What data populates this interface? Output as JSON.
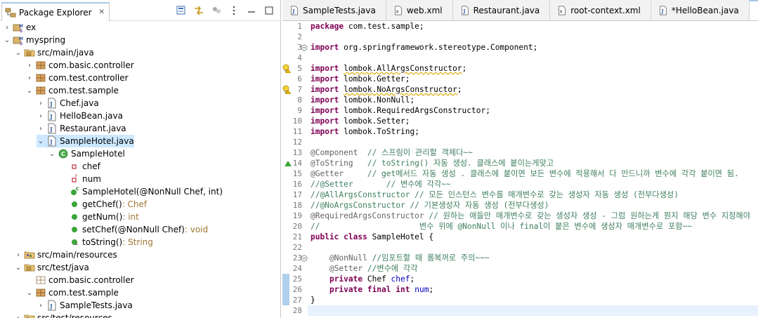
{
  "explorer": {
    "title": "Package Explorer",
    "tree": [
      {
        "label": "ex",
        "twisty": "›",
        "icon": "project",
        "indent": 0
      },
      {
        "label": "myspring",
        "twisty": "⌄",
        "icon": "project",
        "indent": 0
      },
      {
        "label": "src/main/java",
        "twisty": "⌄",
        "icon": "srcfolder",
        "indent": 1
      },
      {
        "label": "com.basic.controller",
        "twisty": "›",
        "icon": "package",
        "indent": 2
      },
      {
        "label": "com.test.controller",
        "twisty": "›",
        "icon": "package",
        "indent": 2
      },
      {
        "label": "com.test.sample",
        "twisty": "⌄",
        "icon": "package",
        "indent": 2
      },
      {
        "label": "Chef.java",
        "twisty": "›",
        "icon": "javafile",
        "indent": 3
      },
      {
        "label": "HelloBean.java",
        "twisty": "›",
        "icon": "javafile",
        "indent": 3
      },
      {
        "label": "Restaurant.java",
        "twisty": "›",
        "icon": "javafile",
        "indent": 3
      },
      {
        "label": "SampleHotel.java",
        "twisty": "⌄",
        "icon": "javafile",
        "indent": 3,
        "selected": true
      },
      {
        "label": "SampleHotel",
        "twisty": "⌄",
        "icon": "class",
        "indent": 4
      },
      {
        "label": "chef",
        "twisty": "",
        "icon": "field-private",
        "indent": 5
      },
      {
        "label": "num",
        "twisty": "",
        "icon": "field-final",
        "indent": 5
      },
      {
        "label": "SampleHotel(@NonNull Chef, int)",
        "twisty": "",
        "icon": "constructor",
        "indent": 5
      },
      {
        "label": "getChef()",
        "suffix": " : Chef",
        "twisty": "",
        "icon": "method",
        "indent": 5
      },
      {
        "label": "getNum()",
        "suffix": " : int",
        "twisty": "",
        "icon": "method",
        "indent": 5
      },
      {
        "label": "setChef(@NonNull Chef)",
        "suffix": " : void",
        "twisty": "",
        "icon": "method",
        "indent": 5
      },
      {
        "label": "toString()",
        "suffix": " : String",
        "twisty": "",
        "icon": "method-override",
        "indent": 5
      },
      {
        "label": "src/main/resources",
        "twisty": "›",
        "icon": "resfolder",
        "indent": 1
      },
      {
        "label": "src/test/java",
        "twisty": "⌄",
        "icon": "srcfolder",
        "indent": 1
      },
      {
        "label": "com.basic.controller",
        "twisty": "",
        "icon": "package-empty",
        "indent": 2
      },
      {
        "label": "com.test.sample",
        "twisty": "⌄",
        "icon": "package",
        "indent": 2
      },
      {
        "label": "SampleTests.java",
        "twisty": "›",
        "icon": "javafile",
        "indent": 3
      },
      {
        "label": "src/test/resources",
        "twisty": "›",
        "icon": "resfolder",
        "indent": 1
      }
    ]
  },
  "editor": {
    "tabs": [
      {
        "label": "SampleTests.java",
        "icon": "java"
      },
      {
        "label": "web.xml",
        "icon": "xml"
      },
      {
        "label": "Restaurant.java",
        "icon": "java"
      },
      {
        "label": "root-context.xml",
        "icon": "xml"
      },
      {
        "label": "*HelloBean.java",
        "icon": "java"
      },
      {
        "label": "*Sa",
        "icon": "java",
        "active": true
      }
    ],
    "lines": [
      {
        "n": "1",
        "segs": [
          [
            "kw",
            "package"
          ],
          [
            "",
            "com.test.sample;"
          ]
        ]
      },
      {
        "n": "2",
        "segs": []
      },
      {
        "n": "3",
        "fold": true,
        "segs": [
          [
            "kw",
            "import"
          ],
          [
            "",
            " org.springframework.stereotype.Component;"
          ]
        ]
      },
      {
        "n": "4",
        "segs": []
      },
      {
        "n": "5",
        "warn": true,
        "segs": [
          [
            "kw",
            "import"
          ],
          [
            "",
            " "
          ],
          [
            "warn",
            "lombok.AllArgsConstructor"
          ],
          [
            "",
            ";"
          ]
        ]
      },
      {
        "n": "6",
        "segs": [
          [
            "kw",
            "import"
          ],
          [
            "",
            " lombok.Getter;"
          ]
        ]
      },
      {
        "n": "7",
        "warn": true,
        "segs": [
          [
            "kw",
            "import"
          ],
          [
            "",
            " "
          ],
          [
            "warn",
            "lombok.NoArgsConstructor"
          ],
          [
            "",
            ";"
          ]
        ]
      },
      {
        "n": "8",
        "segs": [
          [
            "kw",
            "import"
          ],
          [
            "",
            " lombok.NonNull;"
          ]
        ]
      },
      {
        "n": "9",
        "segs": [
          [
            "kw",
            "import"
          ],
          [
            "",
            " lombok.RequiredArgsConstructor;"
          ]
        ]
      },
      {
        "n": "10",
        "segs": [
          [
            "kw",
            "import"
          ],
          [
            "",
            " lombok.Setter;"
          ]
        ]
      },
      {
        "n": "11",
        "segs": [
          [
            "kw",
            "import"
          ],
          [
            "",
            " lombok.ToString;"
          ]
        ]
      },
      {
        "n": "12",
        "segs": []
      },
      {
        "n": "13",
        "segs": [
          [
            "ann",
            "@Component"
          ],
          [
            "cmt",
            "  // 스프링이 관리할 객체다~~"
          ]
        ]
      },
      {
        "n": "14",
        "override": true,
        "segs": [
          [
            "ann",
            "@ToString"
          ],
          [
            "cmt",
            "   // toString() 자동 생성. 클래스에 붙이는게맞고"
          ]
        ]
      },
      {
        "n": "15",
        "segs": [
          [
            "ann",
            "@Getter"
          ],
          [
            "cmt",
            "     // get메서드 자동 생성 . 클래스에 붙이면 보든 변수에 적용해서 다 만드니까 변수에 각각 붙이면 됨."
          ]
        ]
      },
      {
        "n": "16",
        "segs": [
          [
            "cmt",
            "//@Setter       // 변수에 각각~~"
          ]
        ]
      },
      {
        "n": "17",
        "segs": [
          [
            "cmt",
            "//@AllArgsConstructor // 모든 인스턴스 변수를 매개변수로 갖는 생성자 자동 생성 (전부다생성)"
          ]
        ]
      },
      {
        "n": "18",
        "segs": [
          [
            "cmt",
            "//@NoArgsConstructor // 기본생성자 자동 생성 (전부다생성)"
          ]
        ]
      },
      {
        "n": "19",
        "segs": [
          [
            "ann",
            "@RequiredArgsConstructor"
          ],
          [
            "cmt",
            " // 원하는 애들만 매개변수로 갖는 생성자 생성 - 그럼 원하는게 뭔지 해당 변수 지정해야"
          ]
        ]
      },
      {
        "n": "20",
        "segs": [
          [
            "cmt",
            "//                     변수 위에 @NonNull 이나 final이 붙은 변수에 생성자 매개변수로 포함~~"
          ]
        ]
      },
      {
        "n": "21",
        "segs": [
          [
            "kw",
            "public class"
          ],
          [
            "",
            " SampleHotel {"
          ]
        ]
      },
      {
        "n": "22",
        "segs": []
      },
      {
        "n": "23",
        "fold": true,
        "segs": [
          [
            "",
            "    "
          ],
          [
            "ann",
            "@NonNull"
          ],
          [
            "cmt",
            " //임포트할 때 롬복꺼로 주의~~~"
          ]
        ]
      },
      {
        "n": "24",
        "segs": [
          [
            "",
            "    "
          ],
          [
            "ann",
            "@Setter"
          ],
          [
            "cmt",
            " //변수에 각각"
          ]
        ]
      },
      {
        "n": "25",
        "segs": [
          [
            "",
            "    "
          ],
          [
            "kw",
            "private"
          ],
          [
            "",
            " Chef "
          ],
          [
            "fld",
            "chef"
          ],
          [
            "",
            ";"
          ]
        ]
      },
      {
        "n": "26",
        "segs": [
          [
            "",
            "    "
          ],
          [
            "kw",
            "private final int"
          ],
          [
            "",
            " "
          ],
          [
            "fld",
            "num"
          ],
          [
            "",
            ";"
          ]
        ]
      },
      {
        "n": "27",
        "segs": [
          [
            "",
            "}"
          ]
        ]
      },
      {
        "n": "28",
        "current": true,
        "segs": []
      }
    ]
  }
}
